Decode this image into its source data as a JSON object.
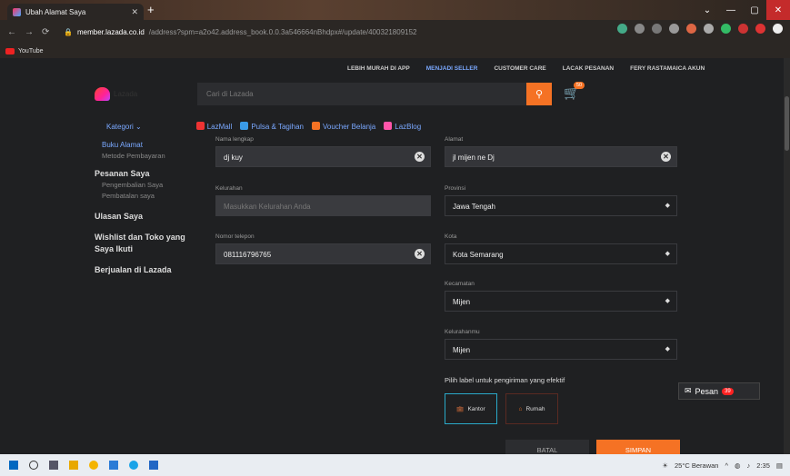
{
  "browser": {
    "tab_title": "Ubah Alamat Saya",
    "url_host": "member.lazada.co.id",
    "url_path": "/address?spm=a2o42.address_book.0.0.3a546664nBhdpx#/update/400321809152",
    "bookmark": "YouTube"
  },
  "header": {
    "links": [
      "LEBIH MURAH DI APP",
      "MENJADI SELLER",
      "CUSTOMER CARE",
      "LACAK PESANAN",
      "FERY RASTAMAICA AKUN"
    ],
    "logo_text": "Lazada",
    "search_placeholder": "Cari di Lazada",
    "cart_count": "50"
  },
  "category": {
    "kategori": "Kategori",
    "links": [
      "LazMall",
      "Pulsa & Tagihan",
      "Voucher Belanja",
      "LazBlog"
    ]
  },
  "sidebar": {
    "buku_alamat": "Buku Alamat",
    "metode": "Metode Pembayaran",
    "pesanan": "Pesanan Saya",
    "pengembalian": "Pengembalian Saya",
    "pembatalan": "Pembatalan saya",
    "ulasan": "Ulasan Saya",
    "wishlist": "Wishlist dan Toko yang Saya Ikuti",
    "berjualan": "Berjualan di Lazada"
  },
  "form": {
    "nama_label": "Nama lengkap",
    "nama_value": "dj kuy",
    "alamat_label": "Alamat",
    "alamat_value": "jl mijen ne Dj",
    "kelurahan_label": "Kelurahan",
    "kelurahan_placeholder": "Masukkan Kelurahan Anda",
    "provinsi_label": "Provinsi",
    "provinsi_value": "Jawa Tengah",
    "telepon_label": "Nomor telepon",
    "telepon_value": "081116796765",
    "kota_label": "Kota",
    "kota_value": "Kota Semarang",
    "kecamatan_label": "Kecamatan",
    "kecamatan_value": "Mijen",
    "kelurahanmu_label": "Kelurahanmu",
    "kelurahanmu_value": "Mijen",
    "label_title": "Pilih label untuk pengiriman yang efektif",
    "kantor": "Kantor",
    "rumah": "Rumah",
    "batal": "BATAL",
    "simpan": "SIMPAN"
  },
  "chat": {
    "label": "Pesan",
    "count": "39"
  },
  "taskbar": {
    "weather": "25°C Berawan",
    "time": "2:35"
  }
}
